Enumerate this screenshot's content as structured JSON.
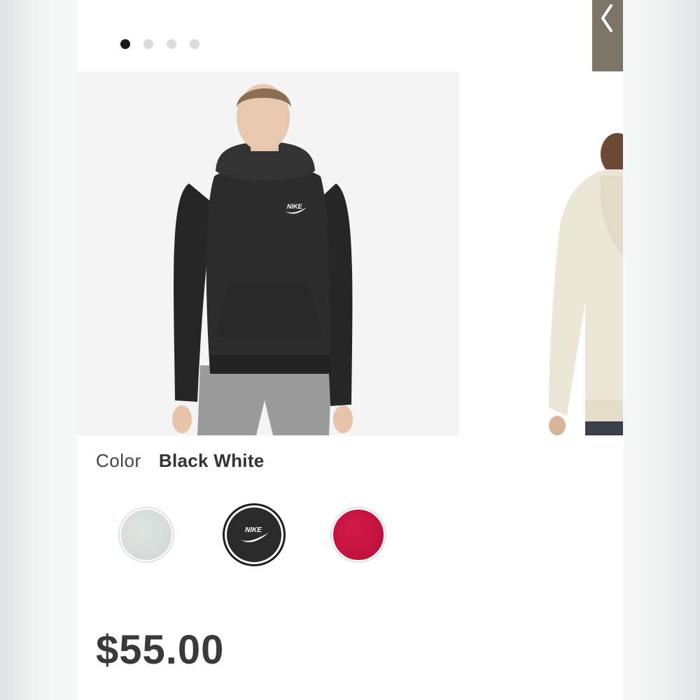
{
  "carousel": {
    "dot_count": 4,
    "active_index": 0
  },
  "navigation": {
    "back_icon": "chevron-left-icon"
  },
  "product": {
    "main_image": "model-wearing-black-funnel-neck-hoodie",
    "next_image": "model-back-view-cream-hoodie",
    "logo_text": "NIKE",
    "color_label": "Color",
    "color_value": "Black White",
    "swatches": [
      {
        "name": "grey-heather",
        "color": "#d6dcd9"
      },
      {
        "name": "black-white",
        "color": "#2a2a2a",
        "selected": true
      },
      {
        "name": "red",
        "color": "#c4143f"
      }
    ],
    "price": "$55.00"
  }
}
